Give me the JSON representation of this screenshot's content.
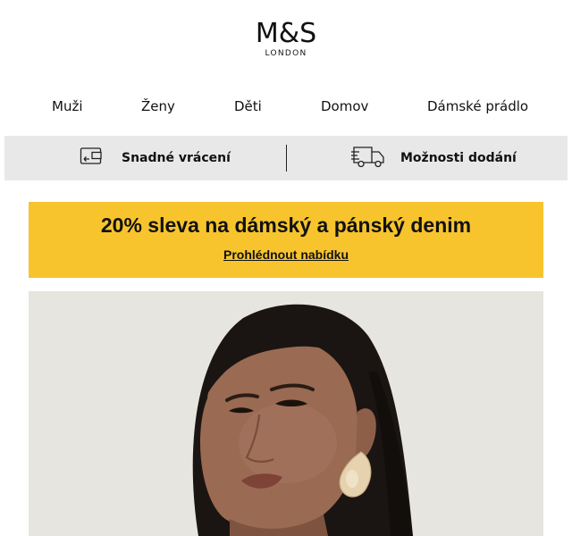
{
  "brand": {
    "name": "M&S",
    "tagline": "LONDON"
  },
  "nav": {
    "items": [
      {
        "label": "Muži"
      },
      {
        "label": "Ženy"
      },
      {
        "label": "Děti"
      },
      {
        "label": "Domov"
      },
      {
        "label": "Dámské prádlo"
      }
    ]
  },
  "services": {
    "returns": {
      "label": "Snadné vrácení",
      "icon": "returns-box-icon"
    },
    "delivery": {
      "label": "Možnosti dodání",
      "icon": "delivery-truck-icon"
    }
  },
  "promo": {
    "title": "20% sleva na dámský a pánský denim",
    "link": "Prohlédnout nabídku",
    "background": "#f7c42e"
  },
  "hero": {
    "image": "model-portrait-with-earring"
  }
}
